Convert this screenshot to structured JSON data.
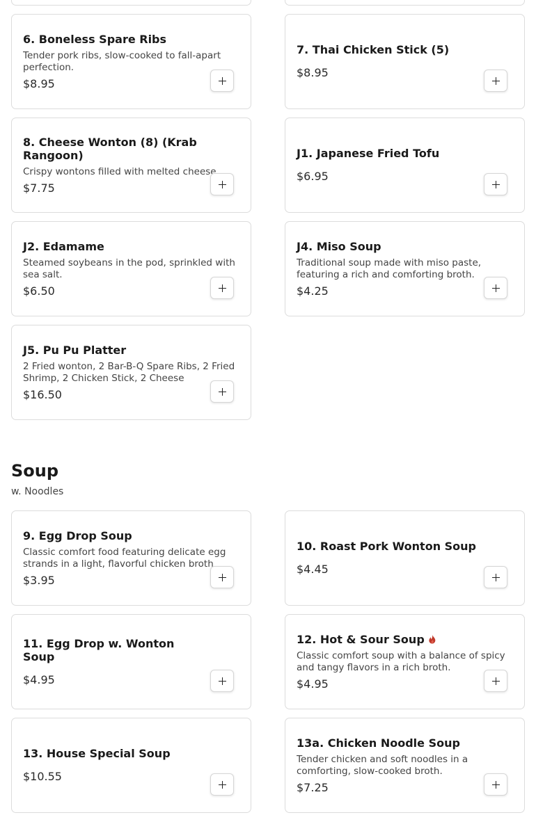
{
  "add_button_label": "+",
  "colors": {
    "spicy": "#c0392b",
    "border": "#dcdcdc"
  },
  "appetizers": {
    "items": [
      {
        "name": "6. Boneless Spare Ribs",
        "description": "Tender pork ribs, slow-cooked to fall-apart perfection.",
        "price": "$8.95"
      },
      {
        "name": "7. Thai Chicken Stick (5)",
        "description": "",
        "price": "$8.95"
      },
      {
        "name": "8. Cheese Wonton (8) (Krab Rangoon)",
        "description": "Crispy wontons filled with melted cheese",
        "price": "$7.75"
      },
      {
        "name": "J1. Japanese Fried Tofu",
        "description": "",
        "price": "$6.95"
      },
      {
        "name": "J2. Edamame",
        "description": "Steamed soybeans in the pod, sprinkled with sea salt.",
        "price": "$6.50"
      },
      {
        "name": "J4. Miso Soup",
        "description": "Traditional soup made with miso paste, featuring a rich and comforting broth.",
        "price": "$4.25"
      },
      {
        "name": "J5. Pu Pu Platter",
        "description": "2 Fried wonton, 2 Bar-B-Q Spare Ribs, 2 Fried Shrimp, 2 Chicken Stick, 2 Cheese",
        "price": "$16.50"
      }
    ]
  },
  "soup": {
    "title": "Soup",
    "subtitle": "w. Noodles",
    "items": [
      {
        "name": "9. Egg Drop Soup",
        "description": "Classic comfort food featuring delicate egg strands in a light, flavorful chicken broth",
        "price": "$3.95"
      },
      {
        "name": "10. Roast Pork Wonton Soup",
        "description": "",
        "price": "$4.45"
      },
      {
        "name": "11. Egg Drop w. Wonton Soup",
        "description": "",
        "price": "$4.95"
      },
      {
        "name": "12. Hot & Sour Soup",
        "spicy_icon": "spicy-flame-icon",
        "description": "Classic comfort soup with a balance of spicy and tangy flavors in a rich broth.",
        "price": "$4.95"
      },
      {
        "name": "13. House Special Soup",
        "description": "",
        "price": "$10.55"
      },
      {
        "name": "13a. Chicken Noodle Soup",
        "description": "Tender chicken and soft noodles in a comforting, slow-cooked broth.",
        "price": "$7.25"
      }
    ]
  }
}
